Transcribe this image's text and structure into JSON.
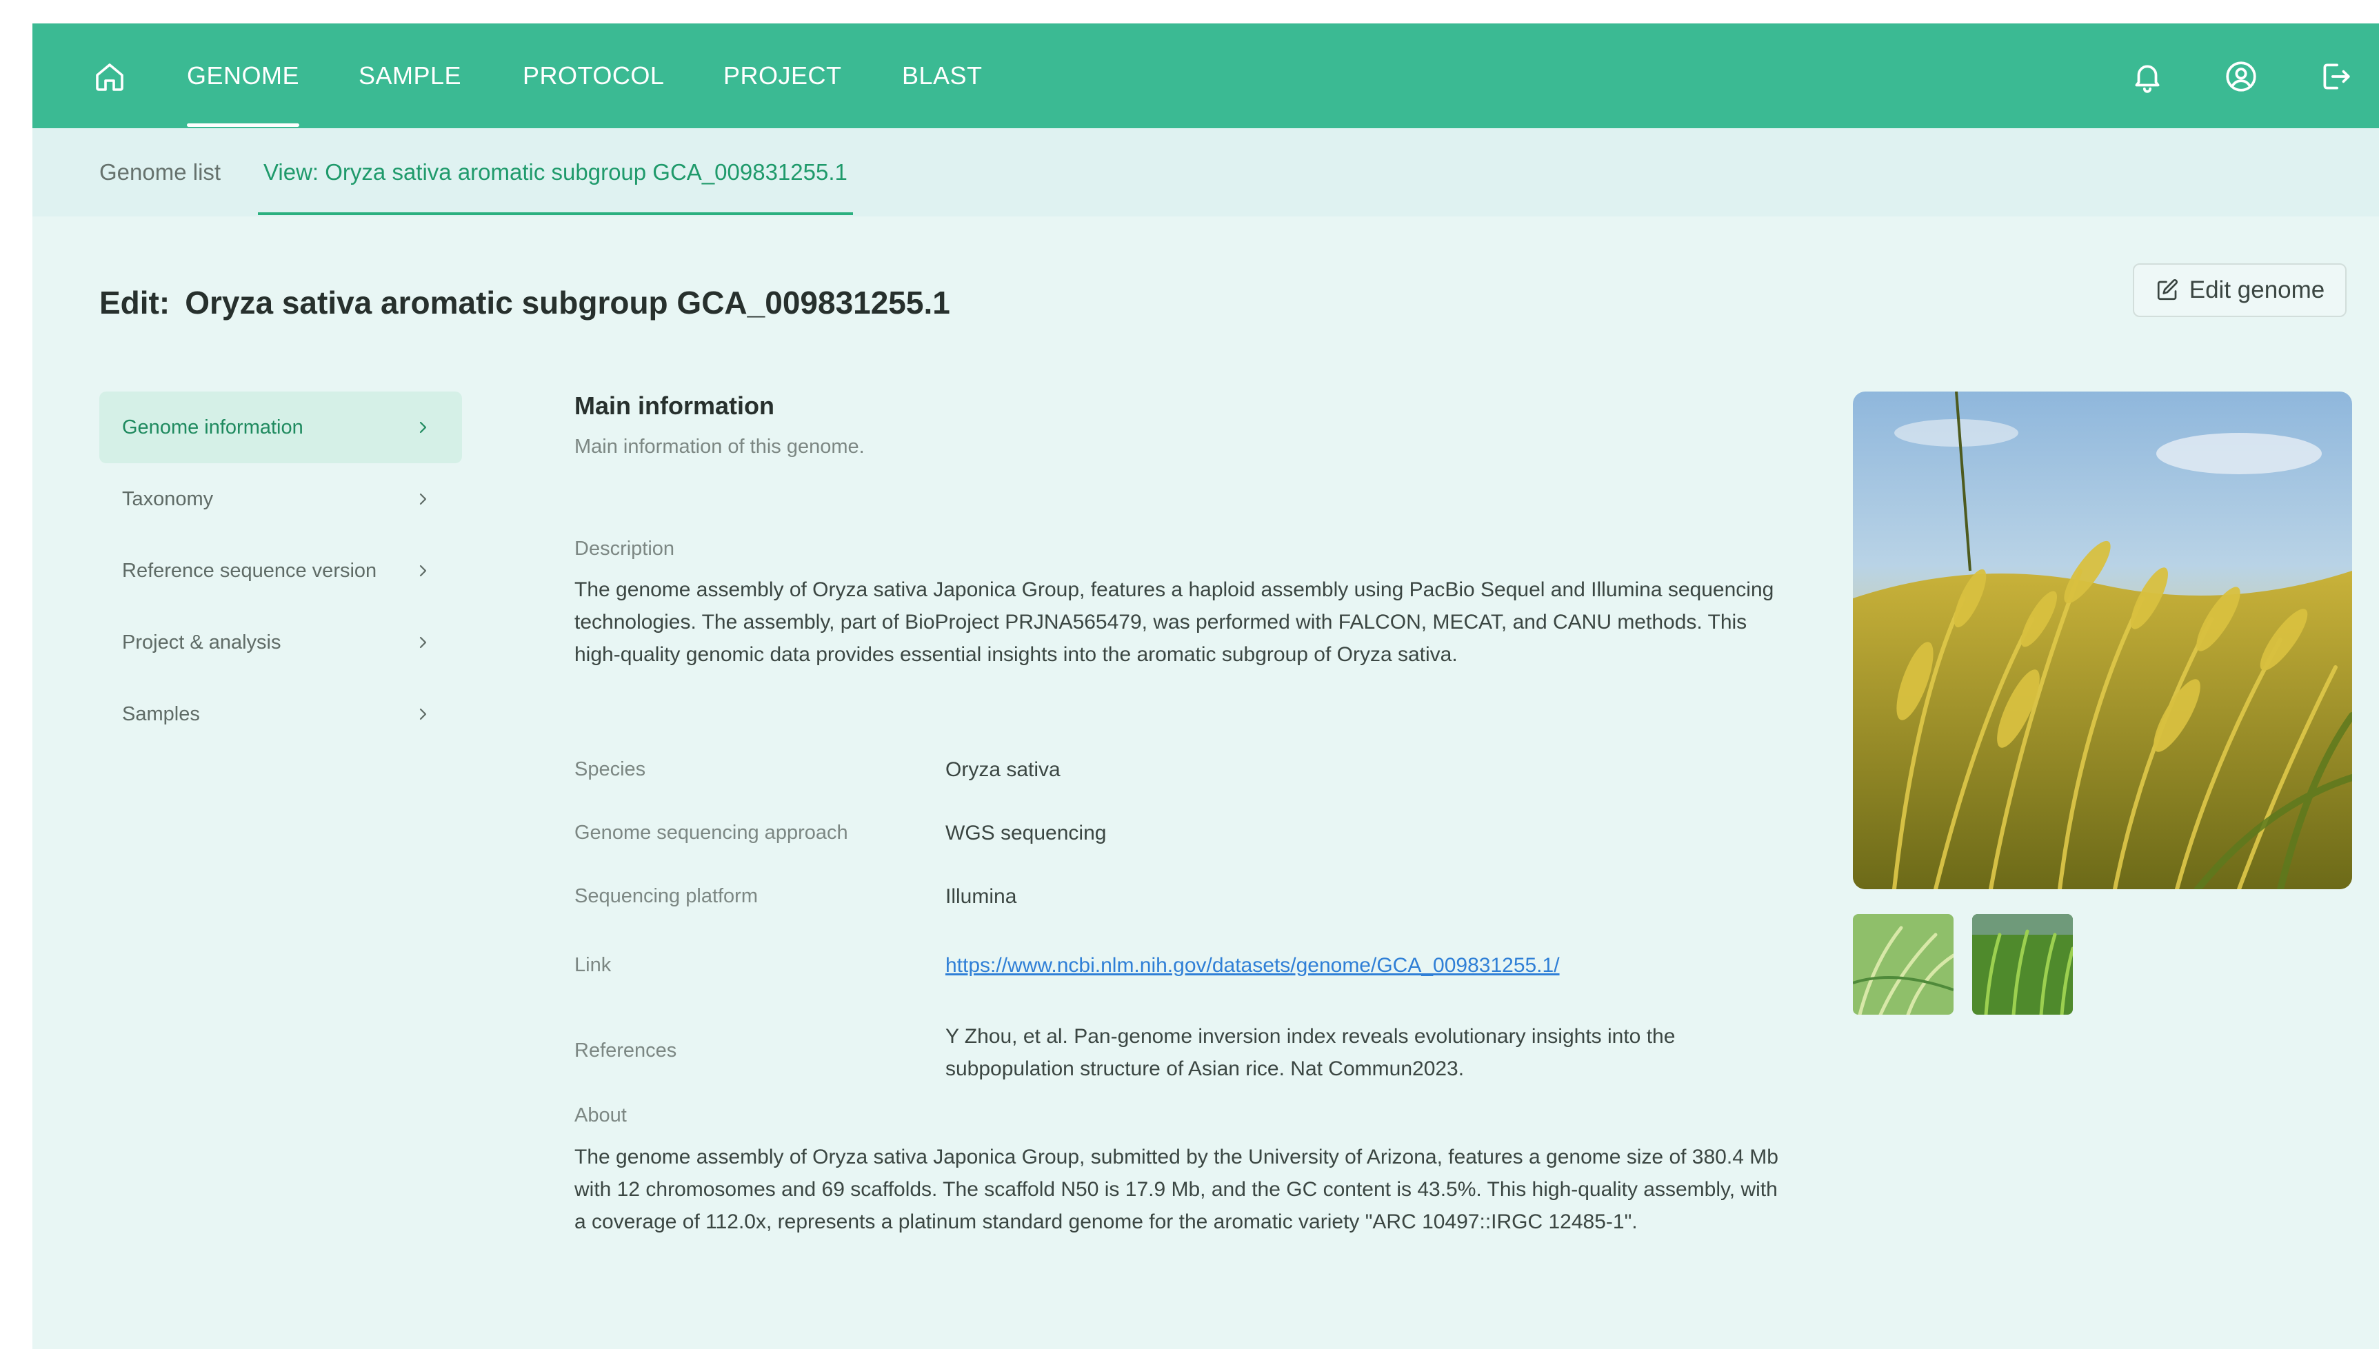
{
  "nav": {
    "home_icon": "home-icon",
    "items": [
      {
        "label": "GENOME",
        "active": true
      },
      {
        "label": "SAMPLE",
        "active": false
      },
      {
        "label": "PROTOCOL",
        "active": false
      },
      {
        "label": "PROJECT",
        "active": false
      },
      {
        "label": "BLAST",
        "active": false
      }
    ],
    "right_icons": [
      "bell-icon",
      "user-circle-icon",
      "logout-icon"
    ]
  },
  "subtabs": [
    {
      "label": "Genome list",
      "active": false
    },
    {
      "label": "View: Oryza sativa aromatic subgroup GCA_009831255.1",
      "active": true
    }
  ],
  "page": {
    "title_prefix": "Edit:",
    "title": "Oryza sativa aromatic subgroup GCA_009831255.1",
    "edit_button": "Edit genome",
    "edit_icon": "edit-icon"
  },
  "sidebar": {
    "items": [
      {
        "label": "Genome information",
        "active": true
      },
      {
        "label": "Taxonomy",
        "active": false
      },
      {
        "label": "Reference sequence version",
        "active": false
      },
      {
        "label": "Project & analysis",
        "active": false
      },
      {
        "label": "Samples",
        "active": false
      }
    ]
  },
  "main": {
    "title": "Main information",
    "subtitle": "Main information of this genome.",
    "description_label": "Description",
    "description": "The genome assembly of Oryza sativa Japonica Group, features a haploid assembly using PacBio Sequel and Illumina sequencing technologies. The assembly, part of BioProject PRJNA565479, was performed with FALCON, MECAT, and CANU methods. This high-quality genomic data provides essential insights into the aromatic subgroup of Oryza sativa.",
    "species_label": "Species",
    "species": "Oryza sativa",
    "approach_label": "Genome sequencing approach",
    "approach": "WGS sequencing",
    "platform_label": "Sequencing platform",
    "platform": "Illumina",
    "link_label": "Link",
    "link": "https://www.ncbi.nlm.nih.gov/datasets/genome/GCA_009831255.1/",
    "references_label": "References",
    "references": "Y Zhou, et al. Pan-genome inversion index reveals evolutionary insights into the subpopulation structure of Asian rice. Nat Commun2023.",
    "about_label": "About",
    "about": "The genome assembly of Oryza sativa Japonica Group, submitted by the University of Arizona, features a genome size of 380.4 Mb with 12 chromosomes and 69 scaffolds. The scaffold N50 is 17.9 Mb, and the GC content is 43.5%. This high-quality assembly, with a coverage of 112.0x, represents a platinum standard genome for the aromatic variety \"ARC 10497::IRGC 12485-1\"."
  },
  "colors": {
    "brand": "#3bba93",
    "accent_text": "#1f9a6b",
    "background": "#e8f6f4",
    "link": "#2f7fd6"
  }
}
